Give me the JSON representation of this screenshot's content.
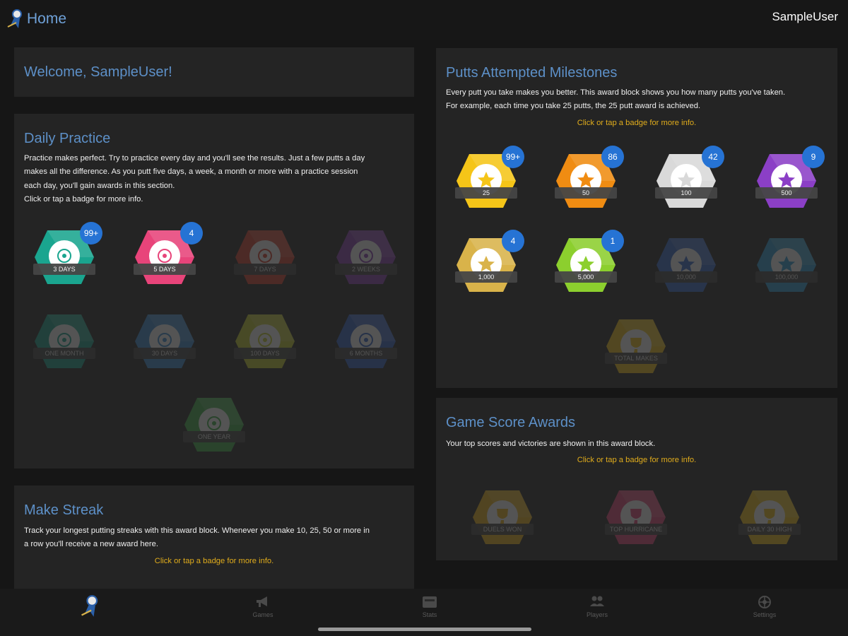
{
  "header": {
    "title": "Home",
    "username": "SampleUser"
  },
  "welcome": {
    "title": "Welcome, SampleUser!"
  },
  "daily_practice": {
    "title": "Daily Practice",
    "lines": [
      "Practice makes perfect. Try to practice every day and you'll see the results. Just a few putts a day",
      "makes all the difference. As you putt five days, a week, a month or more with a practice session",
      "each day, you'll gain awards in this section.",
      "Click or tap a badge for more info."
    ],
    "badges": [
      {
        "label": "3 DAYS",
        "count": "99+",
        "color": "#1aa58f",
        "earned": true
      },
      {
        "label": "5 DAYS",
        "count": "4",
        "color": "#e8447a",
        "earned": true
      },
      {
        "label": "7 DAYS",
        "color": "#d9432e",
        "earned": false
      },
      {
        "label": "2 WEEKS",
        "color": "#8c3fb8",
        "earned": false
      },
      {
        "label": "ONE MONTH",
        "color": "#1aa58f",
        "earned": false
      },
      {
        "label": "30 DAYS",
        "color": "#3b8fd6",
        "earned": false
      },
      {
        "label": "100 DAYS",
        "color": "#c9d230",
        "earned": false
      },
      {
        "label": "6 MONTHS",
        "color": "#3566c9",
        "earned": false
      },
      {
        "label": "ONE YEAR",
        "color": "#3fb34a",
        "earned": false
      }
    ]
  },
  "make_streak": {
    "title": "Make Streak",
    "lines": [
      "Track your longest putting streaks with this award block. Whenever you make 10, 25, 50 or more in",
      "a row you'll receive a new award here."
    ],
    "hint": "Click or tap a badge for more info."
  },
  "putts_attempted": {
    "title": "Putts Attempted Milestones",
    "lines": [
      "Every putt you take makes you better. This award block shows you how many putts you've taken.",
      "For example, each time you take 25 putts, the 25 putt award is achieved."
    ],
    "hint": "Click or tap a badge for more info.",
    "badges": [
      {
        "label": "25",
        "count": "99+",
        "color": "#f5c518",
        "earned": true
      },
      {
        "label": "50",
        "count": "86",
        "color": "#f08c12",
        "earned": true
      },
      {
        "label": "100",
        "count": "42",
        "color": "#d9d9d9",
        "earned": true
      },
      {
        "label": "500",
        "count": "9",
        "color": "#8b3fc6",
        "earned": true
      },
      {
        "label": "1,000",
        "count": "4",
        "color": "#d9b34a",
        "earned": true
      },
      {
        "label": "5,000",
        "count": "1",
        "color": "#8ccf2e",
        "earned": true
      },
      {
        "label": "10,000",
        "color": "#3a6fd0",
        "earned": false
      },
      {
        "label": "100,000",
        "color": "#2fa0d8",
        "earned": false
      },
      {
        "label": "TOTAL MAKES",
        "color": "#f5c518",
        "earned": false,
        "icon": "trophy"
      }
    ]
  },
  "game_score": {
    "title": "Game Score Awards",
    "lines": [
      "Your top scores and victories are shown in this award block."
    ],
    "hint": "Click or tap a badge for more info.",
    "badges": [
      {
        "label": "DUELS WON",
        "color": "#f0b418",
        "earned": false
      },
      {
        "label": "TOP HURRICANE",
        "color": "#e8447a",
        "earned": false
      },
      {
        "label": "DAILY 30 HIGH",
        "color": "#f5c518",
        "earned": false
      }
    ]
  },
  "tabs": [
    {
      "label": "",
      "icon": "home-logo-icon"
    },
    {
      "label": "Games",
      "icon": "megaphone-icon"
    },
    {
      "label": "Stats",
      "icon": "stats-icon"
    },
    {
      "label": "Players",
      "icon": "players-icon"
    },
    {
      "label": "Settings",
      "icon": "settings-icon"
    }
  ]
}
